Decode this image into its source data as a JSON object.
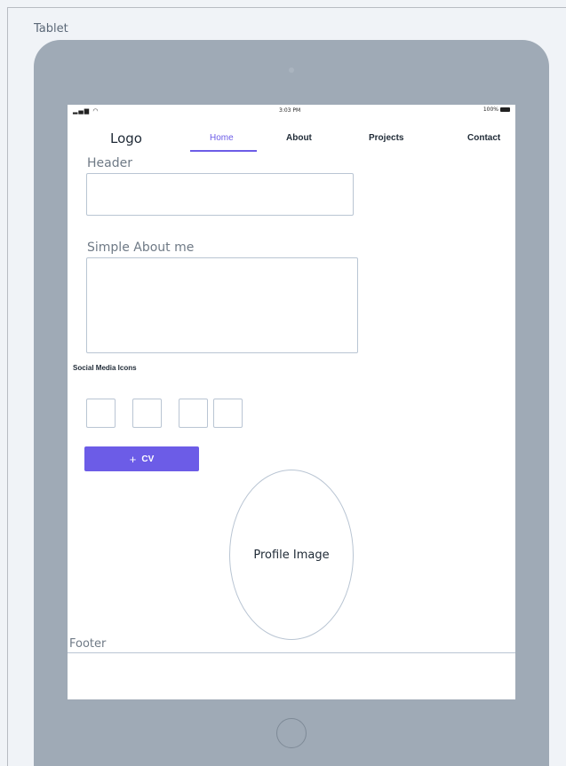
{
  "frame": {
    "label": "Tablet"
  },
  "status_bar": {
    "signal": "▂▄▆ ◠",
    "time": "3:03 PM",
    "battery_text": "100%"
  },
  "nav": {
    "logo": "Logo",
    "items": [
      {
        "label": "Home",
        "active": true
      },
      {
        "label": "About",
        "active": false
      },
      {
        "label": "Projects",
        "active": false
      },
      {
        "label": "Contact",
        "active": false
      }
    ],
    "active_color": "#6c5ce7"
  },
  "content": {
    "header_label": "Header",
    "about_label": "Simple About me",
    "social_label": "Social Media Icons",
    "social_icon_count": 4,
    "cv_button": {
      "icon": "+",
      "label": "CV"
    },
    "profile_image_label": "Profile Image",
    "footer_label": "Footer"
  },
  "colors": {
    "accent": "#6c5ce7",
    "device": "#9faab6",
    "outline": "#b9c5d3"
  }
}
